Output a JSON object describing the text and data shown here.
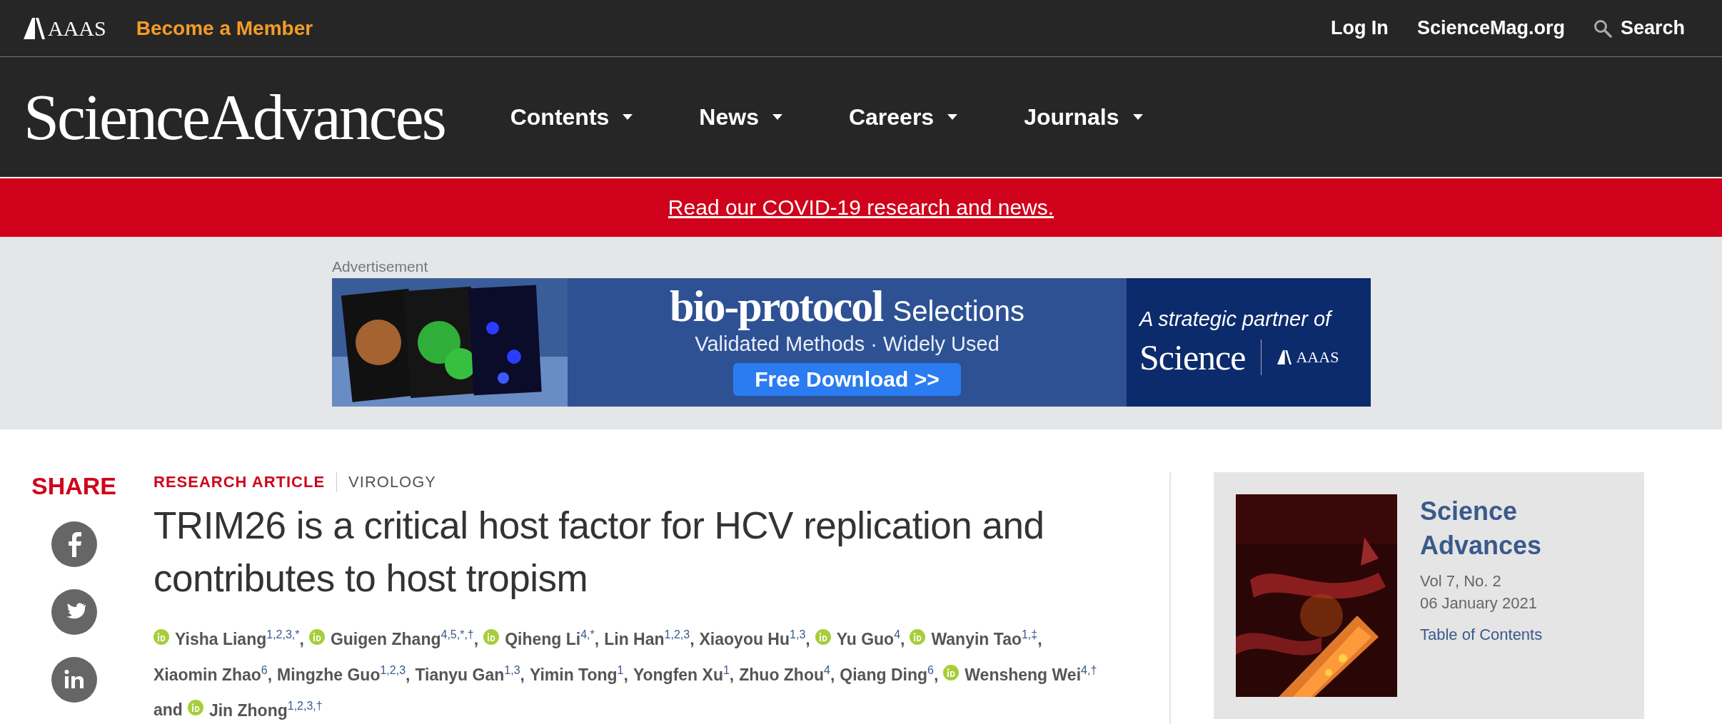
{
  "top_bar": {
    "brand": "AAAS",
    "member_link": "Become a Member",
    "links": [
      "Log In",
      "ScienceMag.org"
    ],
    "search": "Search"
  },
  "masthead": {
    "logo": "ScienceAdvances",
    "nav": [
      {
        "label": "Contents"
      },
      {
        "label": "News"
      },
      {
        "label": "Careers"
      },
      {
        "label": "Journals"
      }
    ]
  },
  "banner": {
    "link": "Read our COVID-19 research and news."
  },
  "advertisement": {
    "label": "Advertisement",
    "brand": "bio-protocol",
    "brand_suffix": "Selections",
    "tagline": "Validated Methods · Widely Used",
    "button": "Free Download >>",
    "partner_text": "A strategic partner of",
    "partner_logo": "Science",
    "partner_org": "AAAS"
  },
  "share": {
    "title": "SHARE",
    "networks": [
      {
        "kind": "facebook"
      },
      {
        "kind": "twitter"
      },
      {
        "kind": "linkedin"
      }
    ]
  },
  "article": {
    "type": "RESEARCH ARTICLE",
    "section": "VIROLOGY",
    "title": "TRIM26 is a critical host factor for HCV replication and contributes to host tropism",
    "authors": [
      {
        "text": "Yisha Liang$^{1,2,3,*}$,",
        "orcid": true
      },
      {
        "text": "Guigen Zhang$^{4,5,*,†}$,",
        "orcid": true
      },
      {
        "text": "Qiheng Li$^{4,*}$,",
        "orcid": true
      },
      {
        "text": "Lin Han$^{1,2,3}$,",
        "orcid": false
      },
      {
        "text": "Xiaoyou Hu$^{1,3}$,",
        "orcid": false
      },
      {
        "text": "Yu Guo$^{4}$,",
        "orcid": true
      },
      {
        "text": "Wanyin Tao$^{1,‡}$,",
        "orcid": true
      },
      {
        "text": "Xiaomin Zhao$^{6}$,",
        "orcid": false
      },
      {
        "text": "Mingzhe Guo$^{1,2,3}$,",
        "orcid": false
      },
      {
        "text": "Tianyu Gan$^{1,3}$,",
        "orcid": false
      },
      {
        "text": "Yimin Tong$^{1}$,",
        "orcid": false
      },
      {
        "text": "Yongfen Xu$^{1}$,",
        "orcid": false
      },
      {
        "text": "Zhuo Zhou$^{4}$,",
        "orcid": false
      },
      {
        "text": "Qiang Ding$^{6}$,",
        "orcid": false
      },
      {
        "text": "Wensheng Wei$^{4,†}$",
        "orcid": true
      },
      {
        "text": "and",
        "orcid": false
      },
      {
        "text": "Jin Zhong$^{1,2,3,†}$",
        "orcid": true
      }
    ]
  },
  "issue": {
    "journal": "Science Advances",
    "volume": "Vol 7, No. 2",
    "date": "06 January 2021",
    "link": "Table of Contents"
  }
}
